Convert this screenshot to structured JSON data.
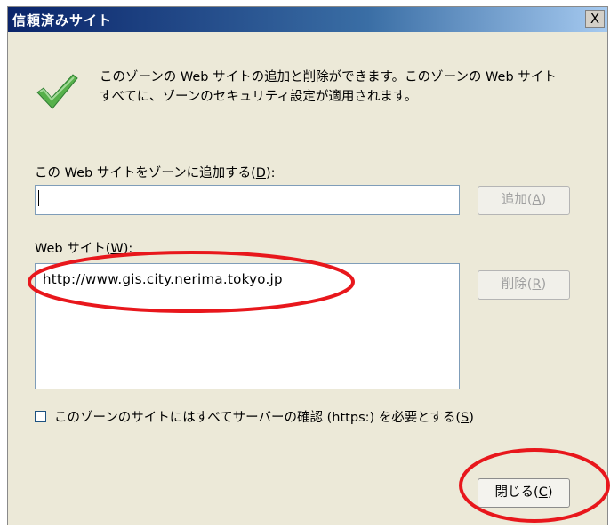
{
  "window": {
    "title": "信頼済みサイト",
    "close_glyph": "X"
  },
  "description": {
    "line1": "このゾーンの Web サイトの追加と削除ができます。このゾーンの Web サイト",
    "line2": "すべてに、ゾーンのセキュリティ設定が適用されます。"
  },
  "add_section": {
    "label_prefix": "この Web サイトをゾーンに追加する(",
    "label_key": "D",
    "label_suffix": "):",
    "input_value": "",
    "add_button_prefix": "追加(",
    "add_button_key": "A",
    "add_button_suffix": ")"
  },
  "sites_section": {
    "label_prefix": "Web サイト(",
    "label_key": "W",
    "label_suffix": "):",
    "sites": [
      "http://www.gis.city.nerima.tokyo.jp"
    ],
    "remove_button_prefix": "削除(",
    "remove_button_key": "R",
    "remove_button_suffix": ")"
  },
  "https_option": {
    "checked": false,
    "label_prefix": "このゾーンのサイトにはすべてサーバーの確認 (https:) を必要とする(",
    "label_key": "S",
    "label_suffix": ")"
  },
  "close_button": {
    "prefix": "閉じる(",
    "key": "C",
    "suffix": ")"
  },
  "colors": {
    "titlebar_start": "#0a246a",
    "dialog_bg": "#ECE9D8",
    "annotation": "#e8171c",
    "check": "#4caf50"
  }
}
